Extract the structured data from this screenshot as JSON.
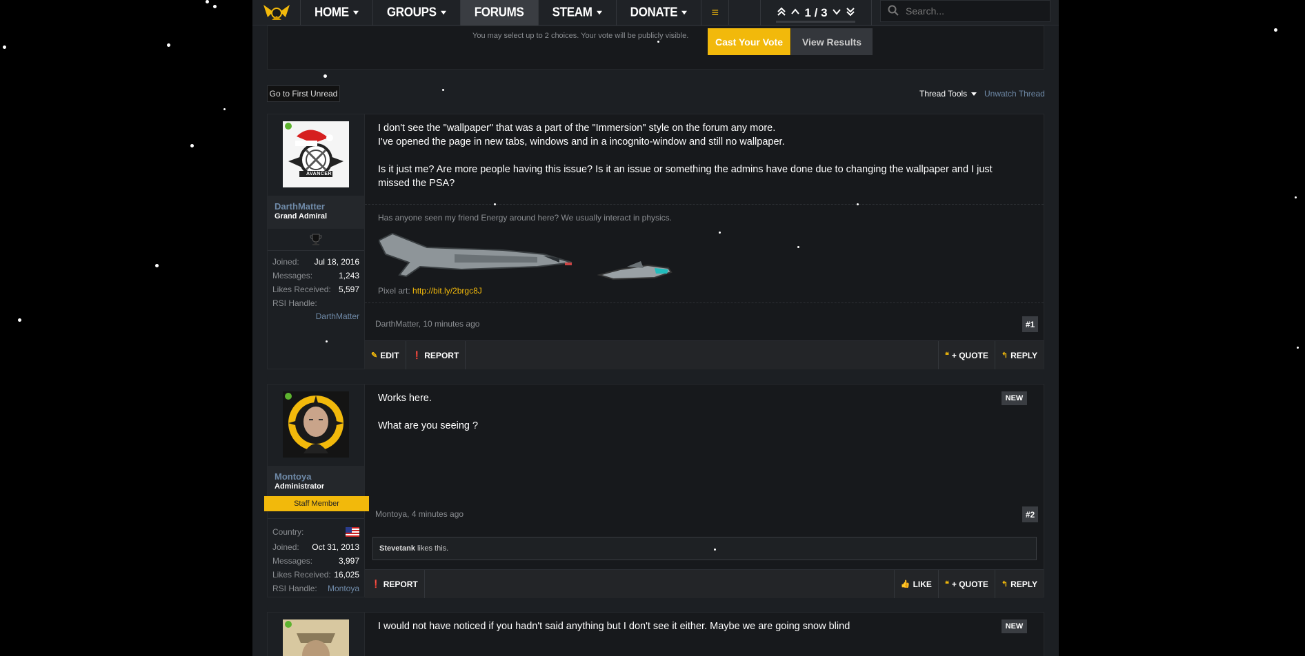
{
  "nav": {
    "tabs": [
      "HOME",
      "GROUPS",
      "FORUMS",
      "STEAM",
      "DONATE"
    ],
    "pager": "1 / 3",
    "search_placeholder": "Search..."
  },
  "poll": {
    "note": "You may select up to 2 choices. Your vote will be publicly visible.",
    "cast_label": "Cast Your Vote",
    "results_label": "View Results"
  },
  "thread": {
    "first_unread": "Go to First Unread",
    "tools_label": "Thread Tools",
    "unwatch_label": "Unwatch Thread"
  },
  "post1": {
    "username": "DarthMatter",
    "title": "Grand Admiral",
    "avatar_text": "AVANCER",
    "extra": [
      {
        "k": "Joined:",
        "v": "Jul 18, 2016"
      },
      {
        "k": "Messages:",
        "v": "1,243"
      },
      {
        "k": "Likes Received:",
        "v": "5,597"
      }
    ],
    "rsi_label": "RSI Handle:",
    "rsi_value": "DarthMatter",
    "lines": [
      "I don't see the \"wallpaper\" that was a part of the \"Immersion\" style on the forum any more.",
      "I've opened the page in new tabs, windows and in a incognito-window and still no wallpaper.",
      "Is it just me? Are more people having this issue? Is it an issue or something the admins have done due to changing the wallpaper and I just",
      "missed the PSA?"
    ],
    "sig_text": "Has anyone seen my friend Energy around here? We usually interact in physics.",
    "sig_pixel_label": "Pixel art:",
    "sig_link": "http://bit.ly/2brgc8J",
    "meta": "DarthMatter, 10 minutes ago",
    "number": "#1",
    "actions_left": [
      "EDIT",
      "REPORT"
    ],
    "actions_right": [
      "+ QUOTE",
      "REPLY"
    ]
  },
  "post2": {
    "username": "Montoya",
    "title": "Administrator",
    "staff": "Staff Member",
    "extra": [
      {
        "k": "Country:",
        "v": ""
      },
      {
        "k": "Joined:",
        "v": "Oct 31, 2013"
      },
      {
        "k": "Messages:",
        "v": "3,997"
      },
      {
        "k": "Likes Received:",
        "v": "16,025"
      }
    ],
    "rsi_label": "RSI Handle:",
    "rsi_value": "Montoya",
    "line1": "Works here.",
    "line2": "What are you seeing ?",
    "badge": "NEW",
    "meta": "Montoya, 4 minutes ago",
    "number": "#2",
    "likes_user": "Stevetank",
    "likes_text": "likes this.",
    "actions_left": [
      "REPORT"
    ],
    "actions_right": [
      "LIKE",
      "+ QUOTE",
      "REPLY"
    ]
  },
  "post3": {
    "line1": "I would not have noticed if you hadn't said anything but I don't see it either. Maybe we are going snow blind",
    "badge": "NEW"
  },
  "colors": {
    "accent": "#f2b90b",
    "link": "#6f8aa8",
    "bg": "#1c1f23"
  }
}
